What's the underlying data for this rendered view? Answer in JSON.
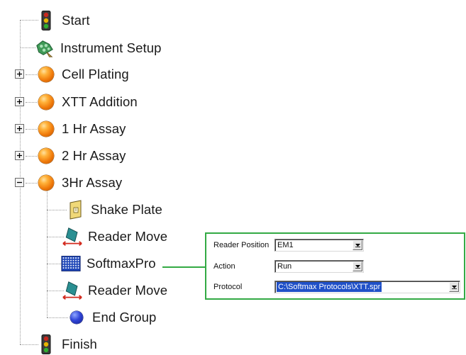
{
  "tree": {
    "start": {
      "label": "Start",
      "icon": "traffic-light-icon"
    },
    "instrument_setup": {
      "label": "Instrument Setup",
      "icon": "instrument-setup-icon"
    },
    "cell_plating": {
      "label": "Cell Plating",
      "icon": "orange-ball-icon",
      "expander": "plus"
    },
    "xtt_addition": {
      "label": "XTT Addition",
      "icon": "orange-ball-icon",
      "expander": "plus"
    },
    "hr1_assay": {
      "label": "1 Hr Assay",
      "icon": "orange-ball-icon",
      "expander": "plus"
    },
    "hr2_assay": {
      "label": "2 Hr Assay",
      "icon": "orange-ball-icon",
      "expander": "plus"
    },
    "hr3_assay": {
      "label": "3Hr Assay",
      "icon": "orange-ball-icon",
      "expander": "minus",
      "children": [
        {
          "label": "Shake Plate",
          "icon": "shake-plate-icon"
        },
        {
          "label": "Reader Move",
          "icon": "reader-move-icon"
        },
        {
          "label": "SoftmaxPro",
          "icon": "microplate-icon"
        },
        {
          "label": "Reader Move",
          "icon": "reader-move-icon"
        },
        {
          "label": "End Group",
          "icon": "blue-ball-icon"
        }
      ]
    },
    "finish": {
      "label": "Finish",
      "icon": "traffic-light-icon"
    }
  },
  "properties": {
    "reader_position": {
      "label": "Reader Position",
      "value": "EM1"
    },
    "action": {
      "label": "Action",
      "value": "Run"
    },
    "protocol": {
      "label": "Protocol",
      "value": "C:\\Softmax Protocols\\XTT.spr"
    }
  },
  "colors": {
    "highlight_green": "#33aa44",
    "selection_blue": "#2050c8"
  }
}
